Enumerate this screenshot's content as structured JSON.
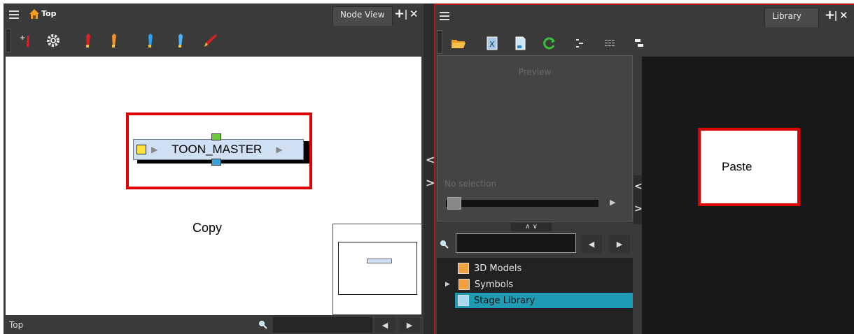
{
  "left_panel": {
    "breadcrumb": "Top",
    "tab_label": "Node View",
    "node_name": "TOON_MASTER",
    "caption": "Copy",
    "status_label": "Top",
    "search_value": ""
  },
  "right_panel": {
    "tab_label": "Library",
    "preview_title": "Preview",
    "no_selection": "No selection",
    "search_value": "",
    "tree": [
      {
        "label": "3D Models"
      },
      {
        "label": "Symbols"
      },
      {
        "label": "Stage Library"
      }
    ],
    "paste_label": "Paste"
  },
  "colors": {
    "panel_bg": "#3a3a3a",
    "canvas_bg": "#ffffff",
    "highlight_red": "#e00000",
    "selected_row": "#1f9cb3",
    "node_fill": "#cfe0f3"
  },
  "icons": {
    "left_toolbar": [
      "add-node-icon",
      "gear-icon",
      "red-brush-icon",
      "orange-brush-icon",
      "blue-brush-icon",
      "blue-brush-2-icon",
      "red-pen-icon"
    ],
    "right_toolbar": [
      "folder-icon",
      "x-sheet-icon",
      "page-icon",
      "refresh-icon",
      "tree-view-icon",
      "list-view-icon",
      "collapse-icon"
    ]
  }
}
